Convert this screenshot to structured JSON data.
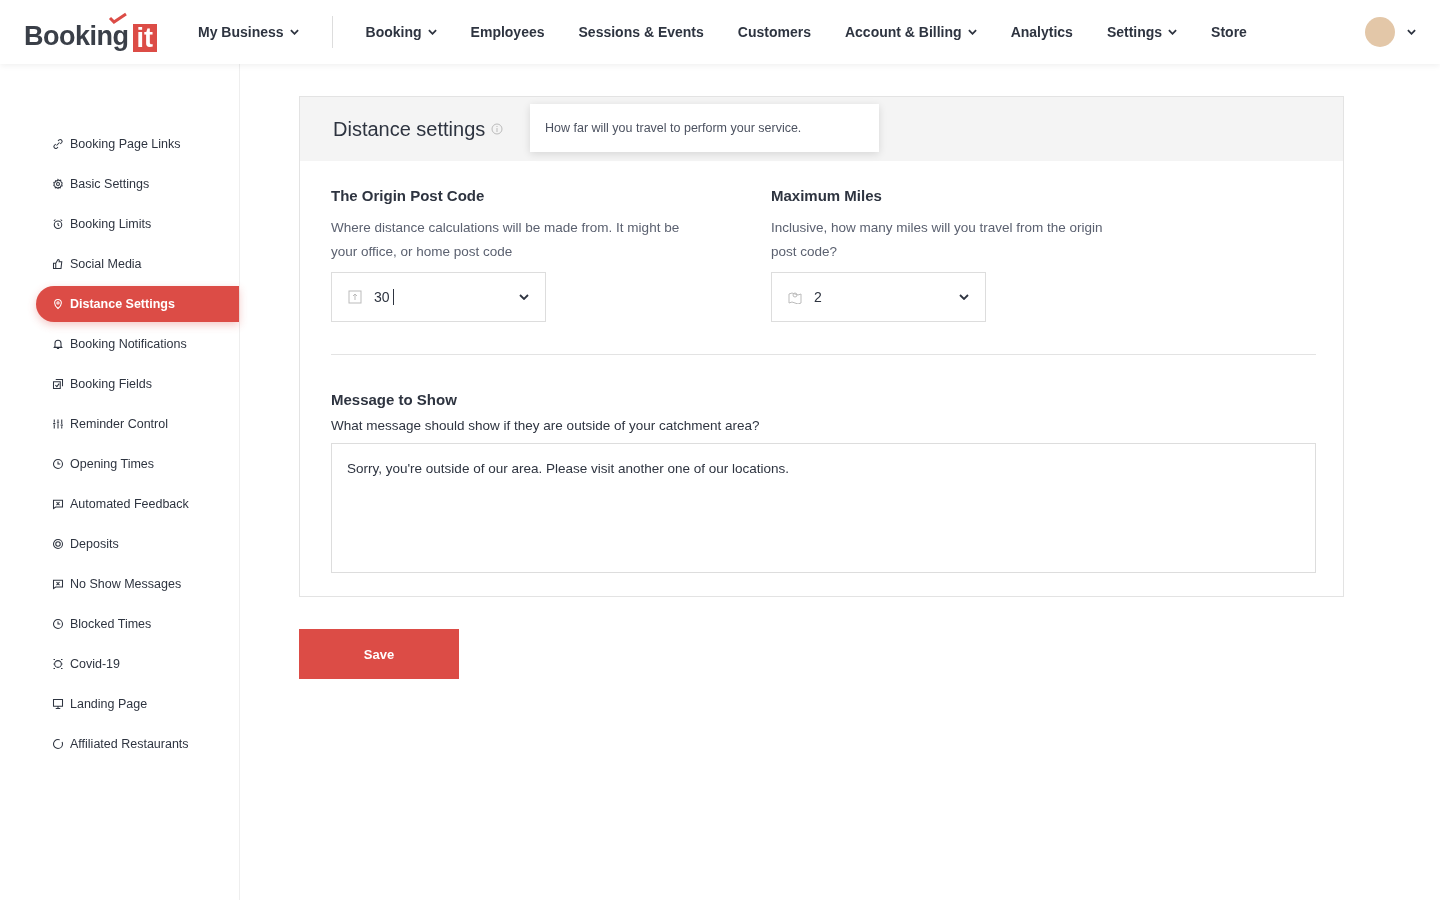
{
  "logo": {
    "word": "Booking",
    "badge": "it"
  },
  "nav": [
    {
      "label": "My Business",
      "dropdown": true
    },
    {
      "label": "Booking",
      "dropdown": true
    },
    {
      "label": "Employees",
      "dropdown": false
    },
    {
      "label": "Sessions & Events",
      "dropdown": false
    },
    {
      "label": "Customers",
      "dropdown": false
    },
    {
      "label": "Account & Billing",
      "dropdown": true
    },
    {
      "label": "Analytics",
      "dropdown": false
    },
    {
      "label": "Settings",
      "dropdown": true
    },
    {
      "label": "Store",
      "dropdown": false
    }
  ],
  "sidebar": {
    "items": [
      {
        "label": "Booking Page Links",
        "selected": false
      },
      {
        "label": "Basic Settings",
        "selected": false
      },
      {
        "label": "Booking Limits",
        "selected": false
      },
      {
        "label": "Social Media",
        "selected": false
      },
      {
        "label": "Distance Settings",
        "selected": true
      },
      {
        "label": "Booking Notifications",
        "selected": false
      },
      {
        "label": "Booking Fields",
        "selected": false
      },
      {
        "label": "Reminder Control",
        "selected": false
      },
      {
        "label": "Opening Times",
        "selected": false
      },
      {
        "label": "Automated Feedback",
        "selected": false
      },
      {
        "label": "Deposits",
        "selected": false
      },
      {
        "label": "No Show Messages",
        "selected": false
      },
      {
        "label": "Blocked Times",
        "selected": false
      },
      {
        "label": "Covid-19",
        "selected": false
      },
      {
        "label": "Landing Page",
        "selected": false
      },
      {
        "label": "Affiliated Restaurants",
        "selected": false
      }
    ]
  },
  "card": {
    "title": "Distance settings",
    "tooltip": "How far will you travel to perform your service.",
    "fields": [
      {
        "label": "The Origin Post Code",
        "help": "Where distance calculations will be made from. It might be your office, or home post code",
        "value": "30",
        "focused": true
      },
      {
        "label": "Maximum Miles",
        "help": "Inclusive, how many miles will you travel from the origin post code?",
        "value": "2",
        "focused": false
      }
    ],
    "message": {
      "label": "Message to Show",
      "help": "What message should show if they are outside of your catchment area?",
      "value": "Sorry, you're outside of our area. Please visit another one of our locations."
    }
  },
  "save_button": "Save"
}
